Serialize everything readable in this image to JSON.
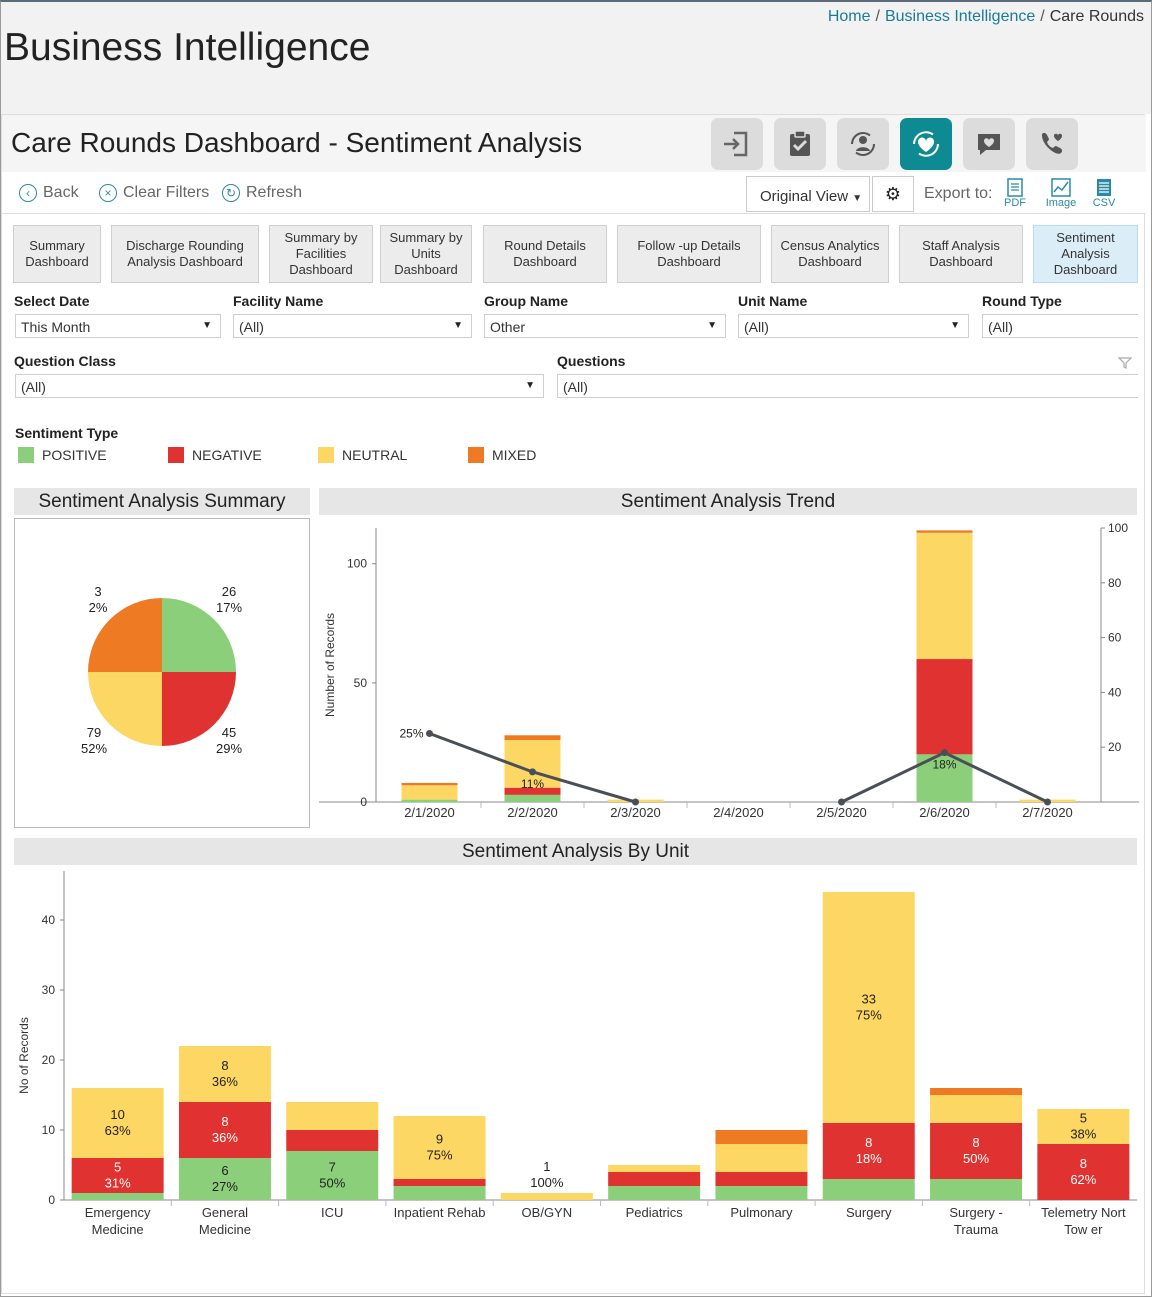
{
  "breadcrumb": {
    "home": "Home",
    "bi": "Business Intelligence",
    "current": "Care Rounds"
  },
  "page_title": "Business Intelligence",
  "dashboard_title": "Care Rounds Dashboard - Sentiment Analysis",
  "header_icons": [
    "exit-icon",
    "clipboard-check-icon",
    "user-refresh-icon",
    "heart-sync-icon",
    "chat-heart-icon",
    "phone-heart-icon"
  ],
  "toolbar": {
    "back": "Back",
    "clear_filters": "Clear Filters",
    "refresh": "Refresh",
    "view": "Original View",
    "export_label": "Export to:",
    "pdf": "PDF",
    "image": "Image",
    "csv": "CSV"
  },
  "tabs": [
    "Summary Dashboard",
    "Discharge Rounding Analysis Dashboard",
    "Summary by Facilities Dashboard",
    "Summary by Units Dashboard",
    "Round Details Dashboard",
    "Follow -up Details Dashboard",
    "Census Analytics Dashboard",
    "Staff Analysis Dashboard",
    "Sentiment Analysis Dashboard"
  ],
  "filters": {
    "select_date": {
      "label": "Select Date",
      "value": "This Month"
    },
    "facility_name": {
      "label": "Facility Name",
      "value": "(All)"
    },
    "group_name": {
      "label": "Group Name",
      "value": "Other"
    },
    "unit_name": {
      "label": "Unit Name",
      "value": "(All)"
    },
    "round_type": {
      "label": "Round Type",
      "value": "(All)"
    },
    "question_class": {
      "label": "Question Class",
      "value": "(All)"
    },
    "questions": {
      "label": "Questions",
      "value": "(All)"
    }
  },
  "sentiment_legend": {
    "title": "Sentiment Type",
    "items": [
      {
        "label": "POSITIVE",
        "color": "#8ccf7a"
      },
      {
        "label": "NEGATIVE",
        "color": "#e03331"
      },
      {
        "label": "NEUTRAL",
        "color": "#fdd764"
      },
      {
        "label": "MIXED",
        "color": "#ee7a24"
      }
    ]
  },
  "chart_data": [
    {
      "type": "pie",
      "title": "Sentiment Analysis Summary",
      "slices": [
        {
          "name": "POSITIVE",
          "value": 26,
          "pct": "17%",
          "color": "#8ccf7a"
        },
        {
          "name": "NEGATIVE",
          "value": 45,
          "pct": "29%",
          "color": "#e03331"
        },
        {
          "name": "NEUTRAL",
          "value": 79,
          "pct": "52%",
          "color": "#fdd764"
        },
        {
          "name": "MIXED",
          "value": 3,
          "pct": "2%",
          "color": "#ee7a24"
        }
      ]
    },
    {
      "type": "bar",
      "title": "Sentiment Analysis Trend",
      "ylabel": "Number of Records",
      "categories": [
        "2/1/2020",
        "2/2/2020",
        "2/3/2020",
        "2/4/2020",
        "2/5/2020",
        "2/6/2020",
        "2/7/2020"
      ],
      "ylim": [
        0,
        115
      ],
      "yticks": [
        0,
        50,
        100
      ],
      "y2lim": [
        0,
        100
      ],
      "y2ticks": [
        20,
        40,
        60,
        80,
        100
      ],
      "series": [
        {
          "name": "POSITIVE",
          "color": "#8ccf7a",
          "values": [
            1,
            3,
            0,
            0,
            0,
            20,
            0
          ]
        },
        {
          "name": "NEGATIVE",
          "color": "#e03331",
          "values": [
            0,
            3,
            0,
            0,
            0,
            40,
            0
          ]
        },
        {
          "name": "NEUTRAL",
          "color": "#fdd764",
          "values": [
            6,
            20,
            1,
            0,
            0,
            53,
            1
          ]
        },
        {
          "name": "MIXED",
          "color": "#ee7a24",
          "values": [
            1,
            2,
            0,
            0,
            0,
            1,
            0
          ]
        }
      ],
      "line": {
        "values": [
          25,
          11,
          0,
          null,
          0,
          18,
          0
        ],
        "labels": [
          "25%",
          "11%",
          "",
          "",
          "",
          "18%",
          ""
        ]
      }
    },
    {
      "type": "bar",
      "title": "Sentiment Analysis By Unit",
      "ylabel": "No of Records",
      "ylim": [
        0,
        47
      ],
      "yticks": [
        0,
        10,
        20,
        30,
        40
      ],
      "categories": [
        "Emergency Medicine",
        "General Medicine",
        "ICU",
        "Inpatient Rehab",
        "OB/GYN",
        "Pediatrics",
        "Pulmonary",
        "Surgery",
        "Surgery - Trauma",
        "Telemetry North Tower"
      ],
      "category_lines": [
        [
          "Emergency",
          "Medicine"
        ],
        [
          "General",
          "Medicine"
        ],
        [
          "ICU"
        ],
        [
          "Inpatient Rehab"
        ],
        [
          "OB/GYN"
        ],
        [
          "Pediatrics"
        ],
        [
          "Pulmonary"
        ],
        [
          "Surgery"
        ],
        [
          "Surgery -",
          "Trauma"
        ],
        [
          "Telemetry Nort",
          "Tow er"
        ]
      ],
      "series": [
        {
          "name": "POSITIVE",
          "color": "#8ccf7a",
          "values": [
            1,
            6,
            7,
            2,
            0,
            2,
            2,
            3,
            3,
            0
          ]
        },
        {
          "name": "NEGATIVE",
          "color": "#e03331",
          "values": [
            5,
            8,
            3,
            1,
            0,
            2,
            2,
            8,
            8,
            8
          ]
        },
        {
          "name": "NEUTRAL",
          "color": "#fdd764",
          "values": [
            10,
            8,
            4,
            9,
            1,
            1,
            4,
            33,
            4,
            5
          ]
        },
        {
          "name": "MIXED",
          "color": "#ee7a24",
          "values": [
            0,
            0,
            0,
            0,
            0,
            0,
            2,
            0,
            1,
            0
          ]
        }
      ],
      "data_labels": [
        {
          "cat": 0,
          "series": "NEGATIVE",
          "lines": [
            "5",
            "31%"
          ]
        },
        {
          "cat": 0,
          "series": "NEUTRAL",
          "lines": [
            "10",
            "63%"
          ]
        },
        {
          "cat": 1,
          "series": "POSITIVE",
          "lines": [
            "6",
            "27%"
          ]
        },
        {
          "cat": 1,
          "series": "NEGATIVE",
          "lines": [
            "8",
            "36%"
          ]
        },
        {
          "cat": 1,
          "series": "NEUTRAL",
          "lines": [
            "8",
            "36%"
          ]
        },
        {
          "cat": 2,
          "series": "POSITIVE",
          "lines": [
            "7",
            "50%"
          ]
        },
        {
          "cat": 3,
          "series": "NEUTRAL",
          "lines": [
            "9",
            "75%"
          ]
        },
        {
          "cat": 4,
          "series": "NEUTRAL",
          "lines": [
            "1",
            "100%"
          ]
        },
        {
          "cat": 7,
          "series": "NEGATIVE",
          "lines": [
            "8",
            "18%"
          ]
        },
        {
          "cat": 7,
          "series": "NEUTRAL",
          "lines": [
            "33",
            "75%"
          ]
        },
        {
          "cat": 8,
          "series": "NEGATIVE",
          "lines": [
            "8",
            "50%"
          ]
        },
        {
          "cat": 9,
          "series": "NEGATIVE",
          "lines": [
            "8",
            "62%"
          ]
        },
        {
          "cat": 9,
          "series": "NEUTRAL",
          "lines": [
            "5",
            "38%"
          ]
        }
      ]
    }
  ]
}
